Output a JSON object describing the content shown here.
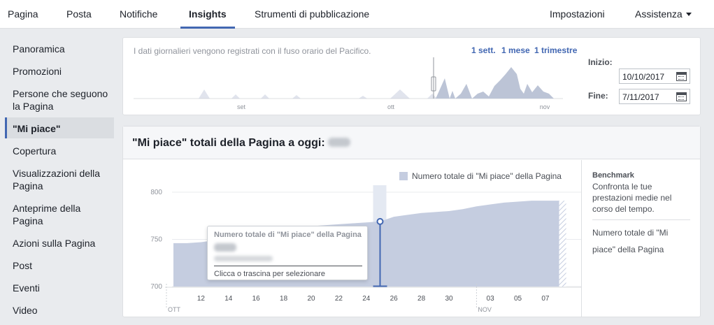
{
  "nav": {
    "left": [
      {
        "label": "Pagina"
      },
      {
        "label": "Posta"
      },
      {
        "label": "Notifiche"
      },
      {
        "label": "Insights"
      },
      {
        "label": "Strumenti di pubblicazione"
      }
    ],
    "right": [
      {
        "label": "Impostazioni"
      },
      {
        "label": "Assistenza"
      }
    ],
    "active": "Insights"
  },
  "sidebar": {
    "items": [
      {
        "label": "Panoramica"
      },
      {
        "label": "Promozioni"
      },
      {
        "label": "Persone che seguono la Pagina"
      },
      {
        "label": "\"Mi piace\""
      },
      {
        "label": "Copertura"
      },
      {
        "label": "Visualizzazioni della Pagina"
      },
      {
        "label": "Anteprime della Pagina"
      },
      {
        "label": "Azioni sulla Pagina"
      },
      {
        "label": "Post"
      },
      {
        "label": "Eventi"
      },
      {
        "label": "Video"
      }
    ],
    "active": "\"Mi piace\""
  },
  "overview": {
    "info": "I dati giornalieri vengono registrati con il fuso orario del Pacifico.",
    "ranges": [
      "1 sett.",
      "1 mese",
      "1 trimestre"
    ],
    "month_labels": [
      "set",
      "ott",
      "nov"
    ],
    "start_label": "Inizio:",
    "start_date": "10/10/2017",
    "end_label": "Fine:",
    "end_date": "7/11/2017"
  },
  "main": {
    "title": "\"Mi piace\" totali della Pagina a oggi:",
    "legend": "Numero totale di \"Mi piace\" della Pagina",
    "benchmark_title": "Benchmark",
    "benchmark_desc": "Confronta le tue prestazioni medie nel corso del tempo.",
    "benchmark_link": "Numero totale di \"Mi piace\" della Pagina"
  },
  "tooltip": {
    "title": "Numero totale di \"Mi piace\" della Pagina",
    "hint": "Clicca o trascina per selezionare"
  },
  "colors": {
    "accent": "#4267b2",
    "area_fill": "#c5cde0",
    "mini_fill": "#bcc4d6"
  },
  "chart_data": {
    "type": "area",
    "x_tick_labels": [
      "12",
      "14",
      "16",
      "18",
      "20",
      "22",
      "24",
      "26",
      "28",
      "30",
      "03",
      "05",
      "07"
    ],
    "month_labels": [
      "OTT",
      "NOV"
    ],
    "ylim": [
      700,
      800
    ],
    "y_ticks": [
      700,
      750,
      800
    ],
    "series": [
      {
        "name": "Numero totale di \"Mi piace\" della Pagina",
        "x": [
          "10",
          "11",
          "12",
          "13",
          "14",
          "15",
          "16",
          "17",
          "18",
          "19",
          "20",
          "21",
          "22",
          "23",
          "24",
          "25",
          "26",
          "27",
          "28",
          "29",
          "30",
          "31",
          "01",
          "02",
          "03",
          "04",
          "05",
          "06",
          "07"
        ],
        "values": [
          746,
          746,
          747,
          749,
          751,
          754,
          757,
          759,
          761,
          763,
          764,
          765,
          766,
          767,
          768,
          769,
          774,
          776,
          778,
          779,
          780,
          782,
          785,
          787,
          789,
          790,
          791,
          791,
          791
        ]
      }
    ],
    "highlight_index": 15,
    "grid": "horizontal"
  }
}
